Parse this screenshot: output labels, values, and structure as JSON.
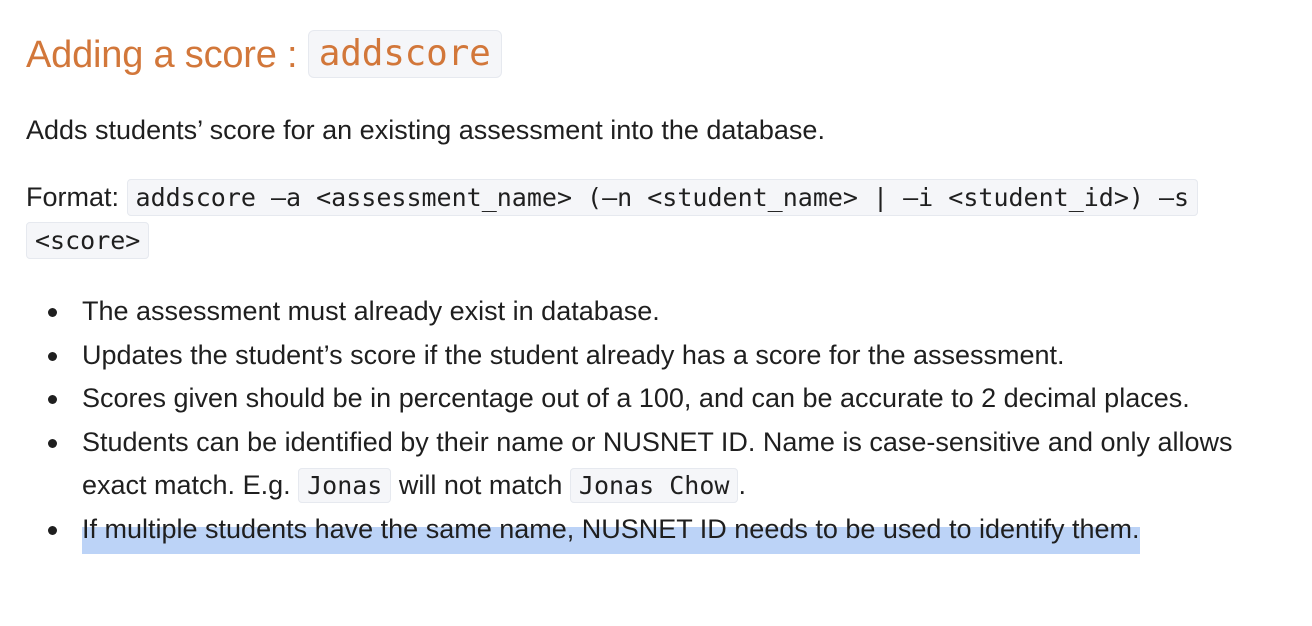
{
  "section": {
    "title_prefix": "Adding a score : ",
    "title_code": "addscore",
    "description": "Adds students’ score for an existing assessment into the database.",
    "format_label": "Format: ",
    "format_code": "addscore –a <assessment_name> (–n <student_name> | –i <student_id>) –s <score>"
  },
  "bullets": {
    "b1": "The assessment must already exist in database.",
    "b2": "Updates the student’s score if the student already has a score for the assessment.",
    "b3": "Scores given should be in percentage out of a 100, and can be accurate to 2 decimal places.",
    "b4_text_before": "Students can be identified by their name or NUSNET ID. Name is case-sensitive and only allows exact match. E.g. ",
    "b4_code1": "Jonas",
    "b4_text_middle": " will not match ",
    "b4_code2": "Jonas Chow",
    "b4_text_after": ".",
    "b5": "If multiple students have the same name, NUSNET ID needs to be used to identify them."
  }
}
